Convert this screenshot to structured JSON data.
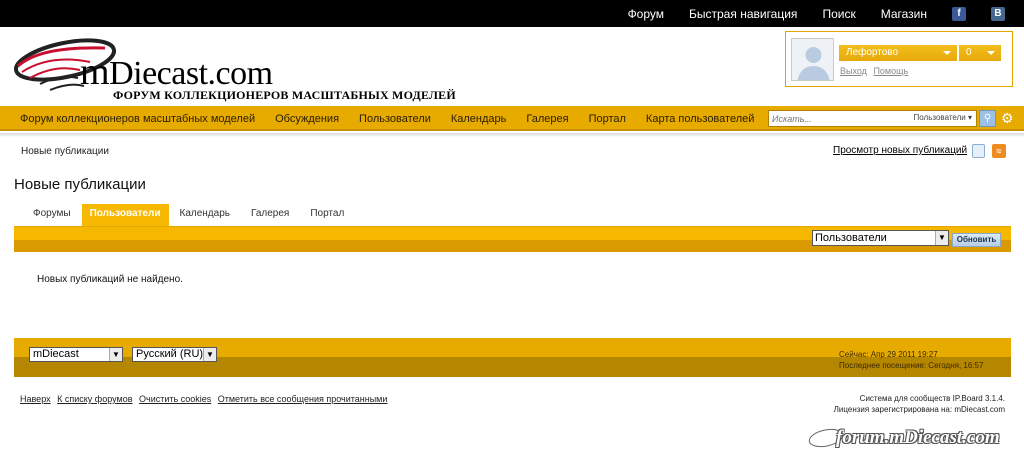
{
  "topbar": {
    "links": [
      "Форум",
      "Быстрая навигация",
      "Поиск",
      "Магазин"
    ],
    "facebook_glyph": "f",
    "vk_glyph": "B"
  },
  "logo": {
    "brand_m": "m",
    "brand_rest": "Diecast.com",
    "tagline": "ФОРУМ КОЛЛЕКЦИОНЕРОВ МАСШТАБНЫХ МОДЕЛЕЙ",
    "icon": "swoosh-logo-icon"
  },
  "user": {
    "name": "Лефортово",
    "count": "0",
    "links": [
      "Выход",
      "Помощь"
    ]
  },
  "mainnav": {
    "items": [
      "Форум коллекционеров масштабных моделей",
      "Обсуждения",
      "Пользователи",
      "Календарь",
      "Галерея",
      "Портал",
      "Карта пользователей"
    ]
  },
  "search": {
    "placeholder": "Искать...",
    "scope": "Пользователи"
  },
  "breadcrumb": "Новые публикации",
  "view_new": "Просмотр новых публикаций",
  "page_title": "Новые публикации",
  "tabs": [
    {
      "label": "Форумы",
      "active": false
    },
    {
      "label": "Пользователи",
      "active": true
    },
    {
      "label": "Календарь",
      "active": false
    },
    {
      "label": "Галерея",
      "active": false
    },
    {
      "label": "Портал",
      "active": false
    }
  ],
  "filter": {
    "selected": "Пользователи",
    "refresh": "Обновить"
  },
  "no_results": "Новых публикаций не найдено.",
  "footer": {
    "skin": "mDiecast",
    "language": "Русский (RU)",
    "now": "Сейчас: Апр 29 2011 19:27",
    "last_visit": "Последнее посещение: Сегодня, 16:57"
  },
  "bottom_links": [
    "Наверх",
    "К списку форумов",
    "Очистить cookies",
    "Отметить все сообщения прочитанными"
  ],
  "powered": {
    "line1": "Система для сообществ IP.Board 3.1.4.",
    "line2": "Лицензия зарегистрирована на: mDiecast.com"
  },
  "watermark": "forum.mDiecast.com",
  "colors": {
    "accent": "#e7ab00",
    "tab_active": "#f6b800",
    "topbar": "#000000"
  }
}
